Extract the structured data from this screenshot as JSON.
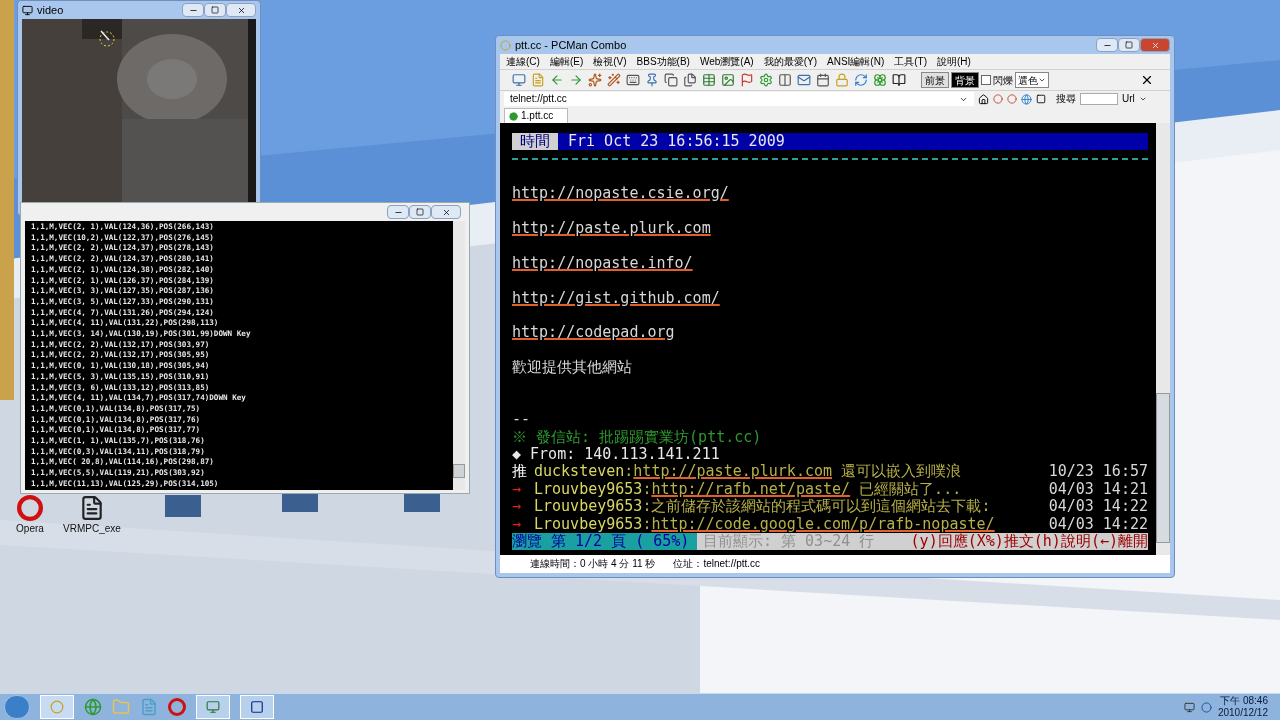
{
  "video_window": {
    "title": "video"
  },
  "console_window": {
    "lines": [
      "1,1,M,VEC(2, 1),VAL(124,36),POS(266,143)",
      "1,1,M,VEC(10,2),VAL(122,37),POS(276,145)",
      "1,1,M,VEC(2, 2),VAL(124,37),POS(278,143)",
      "1,1,M,VEC(2, 2),VAL(124,37),POS(280,141)",
      "1,1,M,VEC(2, 1),VAL(124,38),POS(282,140)",
      "1,1,M,VEC(2, 1),VAL(126,37),POS(284,139)",
      "1,1,M,VEC(3, 3),VAL(127,35),POS(287,136)",
      "1,1,M,VEC(3, 5),VAL(127,33),POS(290,131)",
      "1,1,M,VEC(4, 7),VAL(131,26),POS(294,124)",
      "1,1,M,VEC(4, 11),VAL(131,22),POS(298,113)",
      "1,1,M,VEC(3, 14),VAL(130,19),POS(301,99)DOWN Key",
      "1,1,M,VEC(2, 2),VAL(132,17),POS(303,97)",
      "1,1,M,VEC(2, 2),VAL(132,17),POS(305,95)",
      "1,1,M,VEC(0, 1),VAL(130,18),POS(305,94)",
      "1,1,M,VEC(5, 3),VAL(135,15),POS(310,91)",
      "1,1,M,VEC(3, 6),VAL(133,12),POS(313,85)",
      "1,1,M,VEC(4, 11),VAL(134,7),POS(317,74)DOWN Key",
      "1,1,M,VEC(0,1),VAL(134,8),POS(317,75)",
      "1,1,M,VEC(0,1),VAL(134,8),POS(317,76)",
      "1,1,M,VEC(0,1),VAL(134,8),POS(317,77)",
      "1,1,M,VEC(1, 1),VAL(135,7),POS(318,76)",
      "1,1,M,VEC(0,3),VAL(134,11),POS(318,79)",
      "1,1,M,VEC( 20,8),VAL(114,16),POS(298,87)",
      "1,1,M,VEC(5,5),VAL(119,21),POS(303,92)",
      "1,1,M,VEC(11,13),VAL(125,29),POS(314,105)"
    ]
  },
  "pcman": {
    "title": "ptt.cc - PCMan Combo",
    "menu": [
      "連線(C)",
      "編輯(E)",
      "檢視(V)",
      "BBS功能(B)",
      "Web瀏覽(A)",
      "我的最愛(Y)",
      "ANSI編輯(N)",
      "工具(T)",
      "說明(H)"
    ],
    "color_buttons": [
      {
        "label": "前景",
        "selected": false
      },
      {
        "label": "背景",
        "selected": true
      }
    ],
    "blink": {
      "label": "閃爍",
      "checked": false
    },
    "color_select": "選色",
    "address": "telnet://ptt.cc",
    "search_label": "搜尋",
    "url_label": "Url",
    "tabs": [
      {
        "label": "1.ptt.cc",
        "selected": true
      }
    ],
    "terminal": {
      "header_label": "時間",
      "header_value": "Fri Oct 23 16:56:15 2009",
      "links": [
        "http://nopaste.csie.org/",
        "http://paste.plurk.com",
        "http://nopaste.info/",
        "http://gist.github.com/",
        "http://codepad.org"
      ],
      "welcome": "歡迎提供其他網站",
      "signature": "--",
      "origin": "※ 發信站: 批踢踢實業坊(ptt.cc)",
      "from": "◆ From: 140.113.141.211",
      "pushes": [
        {
          "kind": "push",
          "tag": "推",
          "user": "ducksteven",
          "segments": [
            {
              "text": ":",
              "link": false
            },
            {
              "text": "http://paste.plurk.com",
              "link": true
            },
            {
              "text": " 還可以嵌入到噗浪",
              "link": false
            }
          ],
          "time": "10/23 16:57"
        },
        {
          "kind": "arrow",
          "tag": "→",
          "user": "Lrouvbey9653",
          "segments": [
            {
              "text": ":",
              "link": false
            },
            {
              "text": "http://rafb.net/paste/",
              "link": true
            },
            {
              "text": " 已經關站了...",
              "link": false
            }
          ],
          "time": "04/03 14:21"
        },
        {
          "kind": "arrow",
          "tag": "→",
          "user": "Lrouvbey9653",
          "segments": [
            {
              "text": ":之前儲存於該網站的程式碼可以到這個網站去下載:",
              "link": false
            }
          ],
          "time": "04/03 14:22"
        },
        {
          "kind": "arrow",
          "tag": "→",
          "user": "Lrouvbey9653",
          "segments": [
            {
              "text": ":",
              "link": false
            },
            {
              "text": "http://code.google.com/p/rafb-nopaste/",
              "link": true
            }
          ],
          "time": "04/03 14:22"
        }
      ],
      "status": {
        "page": "瀏覽 第 1/2 頁 ( 65%)",
        "lines": "目前顯示: 第 03~24 行",
        "keys": "(y)回應(X%)推文(h)說明(←)離開"
      }
    },
    "status_bar": [
      "連線時間：0 小時 4 分 11 秒",
      "位址：telnet://ptt.cc"
    ]
  },
  "desktop_icons": [
    {
      "label": "Opera"
    },
    {
      "label": "VRMPC_exe"
    }
  ],
  "taskbar": {
    "clock_time": "下午 08:46",
    "clock_date": "2010/12/12"
  }
}
